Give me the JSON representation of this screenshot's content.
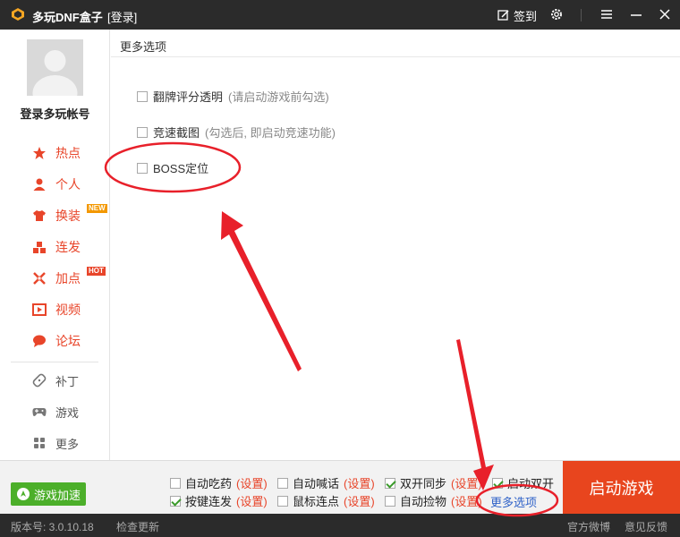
{
  "window": {
    "app_title": "多玩DNF盒子",
    "login_tag": "[登录]",
    "signin_label": "签到"
  },
  "sidebar": {
    "account_label": "登录多玩帐号",
    "main_items": [
      {
        "label": "热点",
        "icon": "star-icon"
      },
      {
        "label": "个人",
        "icon": "person-icon"
      },
      {
        "label": "换装",
        "icon": "shirt-icon",
        "badge": "NEW"
      },
      {
        "label": "连发",
        "icon": "blocks-icon"
      },
      {
        "label": "加点",
        "icon": "crossed-swords-icon",
        "badge": "HOT"
      },
      {
        "label": "视频",
        "icon": "play-icon"
      },
      {
        "label": "论坛",
        "icon": "chat-bubble-icon"
      }
    ],
    "tool_items": [
      {
        "label": "补丁",
        "icon": "bandage-icon"
      },
      {
        "label": "游戏",
        "icon": "gamepad-icon"
      },
      {
        "label": "更多",
        "icon": "grid-icon"
      }
    ]
  },
  "content": {
    "header": "更多选项",
    "options": [
      {
        "label": "翻牌评分透明",
        "hint": "(请启动游戏前勾选)",
        "checked": false
      },
      {
        "label": "竞速截图",
        "hint": "(勾选后, 即启动竞速功能)",
        "checked": false
      },
      {
        "label": "BOSS定位",
        "hint": "",
        "checked": false
      }
    ]
  },
  "bottom": {
    "accel_label": "游戏加速",
    "options": [
      {
        "label": "自动吃药",
        "setting": "(设置)",
        "checked": false
      },
      {
        "label": "自动喊话",
        "setting": "(设置)",
        "checked": false
      },
      {
        "label": "双开同步",
        "setting": "(设置)",
        "checked": true
      },
      {
        "label": "启动双开",
        "setting": "",
        "checked": true
      },
      {
        "label": "按键连发",
        "setting": "(设置)",
        "checked": true
      },
      {
        "label": "鼠标连点",
        "setting": "(设置)",
        "checked": false
      },
      {
        "label": "自动捡物",
        "setting": "(设置)",
        "checked": false
      }
    ],
    "more_options": "更多选项",
    "launch_label": "启动游戏"
  },
  "status": {
    "version": "版本号: 3.0.10.18",
    "check_update": "检查更新",
    "weibo": "官方微博",
    "feedback": "意见反馈"
  },
  "colors": {
    "accent_red": "#e8452a",
    "launch_orange": "#e8451e",
    "accel_green": "#4caf2a",
    "link_blue": "#2f62c8",
    "annotation_red": "#e8202a"
  }
}
